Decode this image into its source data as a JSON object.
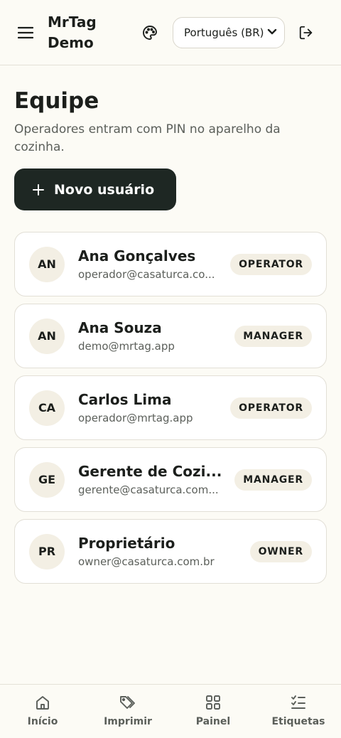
{
  "header": {
    "brand_line1": "MrTag",
    "brand_line2": "Demo",
    "menu_icon": "hamburger-menu-icon",
    "palette_icon": "palette-icon",
    "language_selected": "Português (BR)",
    "logout_icon": "logout-icon"
  },
  "page": {
    "title": "Equipe",
    "subtitle": "Operadores entram com PIN no aparelho da cozinha.",
    "new_user_label": "Novo usuário"
  },
  "users": [
    {
      "initials": "AN",
      "name": "Ana Gonçalves",
      "email": "operador@casaturca.co...",
      "role": "OPERATOR"
    },
    {
      "initials": "AN",
      "name": "Ana Souza",
      "email": "demo@mrtag.app",
      "role": "MANAGER"
    },
    {
      "initials": "CA",
      "name": "Carlos Lima",
      "email": "operador@mrtag.app",
      "role": "OPERATOR"
    },
    {
      "initials": "GE",
      "name": "Gerente de Cozi...",
      "email": "gerente@casaturca.com...",
      "role": "MANAGER"
    },
    {
      "initials": "PR",
      "name": "Proprietário",
      "email": "owner@casaturca.com.br",
      "role": "OWNER"
    }
  ],
  "bottom_nav": [
    {
      "label": "Início",
      "icon": "home-icon"
    },
    {
      "label": "Imprimir",
      "icon": "tags-icon"
    },
    {
      "label": "Painel",
      "icon": "grid-icon"
    },
    {
      "label": "Etiquetas",
      "icon": "checklist-icon"
    }
  ],
  "colors": {
    "background": "#fcfbf5",
    "primary_button": "#1e2723",
    "badge_bg": "#f3efe4",
    "text": "#1c1f1c",
    "muted_text": "#5b5f5a"
  }
}
